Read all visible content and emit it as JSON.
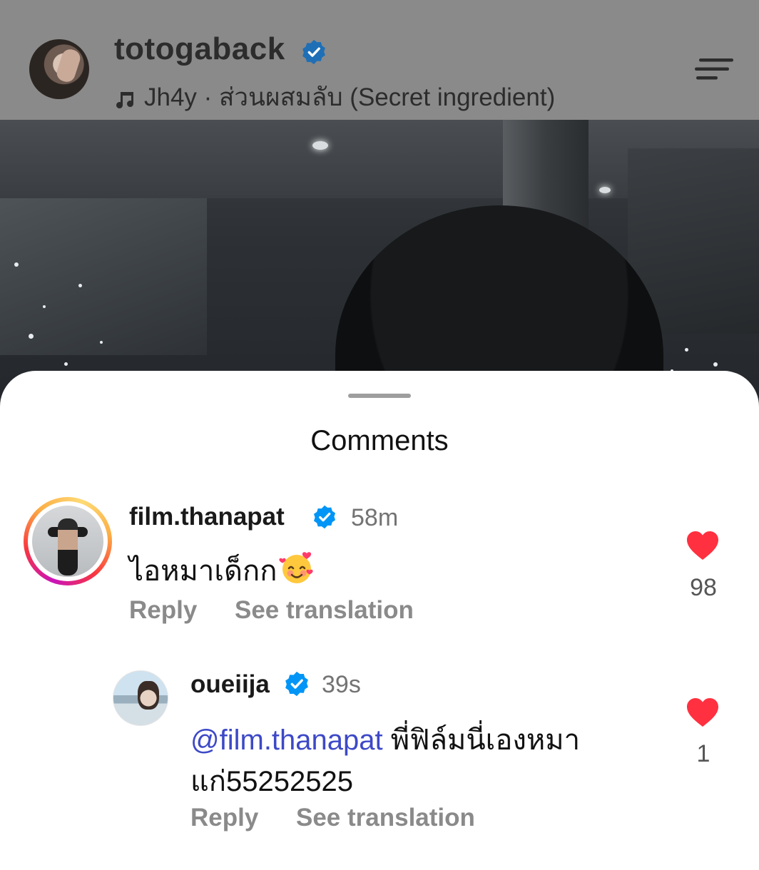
{
  "header": {
    "username": "totogaback",
    "music": "Jh4y · ส่วนผสมลับ (Secret ingredient)"
  },
  "sheet": {
    "title": "Comments"
  },
  "comments": [
    {
      "username": "film.thanapat",
      "time": "58m",
      "text": "ไอหมาเด็กก",
      "emoji": "smiling-face-with-hearts",
      "reply_label": "Reply",
      "translate_label": "See translation",
      "likes": "98",
      "liked": true
    },
    {
      "username": "oueiija",
      "time": "39s",
      "mention": "@film.thanapat",
      "text_line1": " พี่ฟิล์มนี่เองหมา",
      "text_line2": "แก่55252525",
      "reply_label": "Reply",
      "translate_label": "See translation",
      "likes": "1",
      "liked": true
    }
  ],
  "colors": {
    "verified": "#0095f6",
    "heart": "#ff3040",
    "mention": "#3d49c7"
  }
}
